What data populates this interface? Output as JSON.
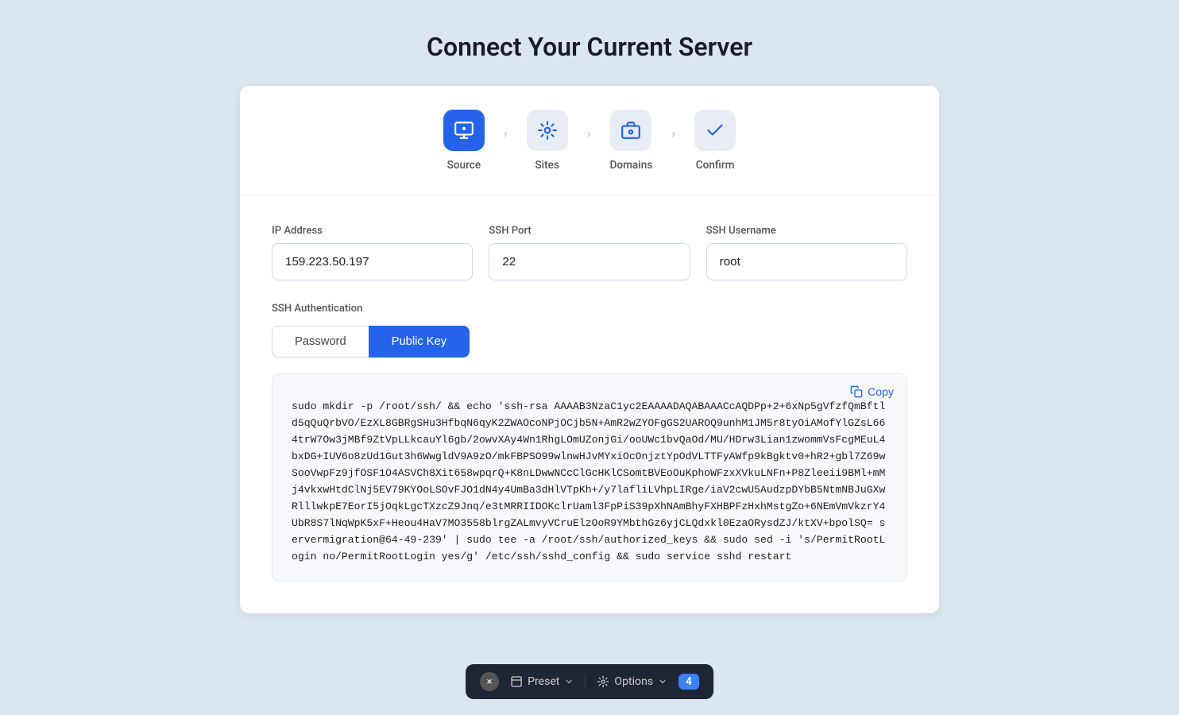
{
  "page": {
    "title": "Connect Your Current Server"
  },
  "steps": [
    {
      "id": "source",
      "label": "Source",
      "state": "active"
    },
    {
      "id": "sites",
      "label": "Sites",
      "state": "inactive"
    },
    {
      "id": "domains",
      "label": "Domains",
      "state": "inactive"
    },
    {
      "id": "confirm",
      "label": "Confirm",
      "state": "inactive"
    }
  ],
  "form": {
    "ip_address_label": "IP Address",
    "ip_address_value": "159.223.50.197",
    "ip_address_placeholder": "IP Address",
    "ssh_port_label": "SSH Port",
    "ssh_port_value": "22",
    "ssh_port_placeholder": "SSH Port",
    "ssh_username_label": "SSH Username",
    "ssh_username_value": "root",
    "ssh_username_placeholder": "SSH Username",
    "auth_label": "SSH Authentication",
    "tab_password": "Password",
    "tab_public_key": "Public Key",
    "copy_label": "Copy",
    "command": "sudo mkdir -p /root/ssh/ && echo 'ssh-rsa AAAAB3NzaC1yc2EAAAADAQABAAACcAQDPp+2+6xNp5gVfzfQmBftld5qQuQrbVO/EzXL8GBRgSHu3HfbqN6qyK2ZWAOcoNPjOCjb5N+AmR2wZYOFgGS2UAROQ9unhM1JM5r8tyOiAMofYlGZsL664trW7Ow3jMBf9ZtVpLLkcauYl6gb/2owvXAy4Wn1RhgLOmUZonjGi/ooUWc1bvQaOd/MU/HDrw3Lian1zwommVsFcgMEuL4bxDG+IUV6o8zUd1Gut3h6WwgldV9A9zO/mkFBPSO99wlnwHJvMYxiOcOnjztYpOdVLTTFyAWfp9kBgktv0+hR2+gbl7Z69wSooVwpFz9jfOSF1O4ASVCh8Xit658wpqrQ+K8nLDwwNCcClGcHKlCSomtBVEoOuKphoWFzxXVkuLNFn+P8Zleeii9BMl+mMj4vkxwHtdClNj5EV79KYOoLSOvFJO1dN4y4UmBa3dHlVTpKh+/y7lafliLVhpLIRge/iaV2cwU5AudzpDYbB5NtmNBJuGXwRlllwkpE7EorI5jOqkLgcTXzcZ9Jnq/e3tMRRIIDOKclrUaml3FpPiS39pXhNAmBhyFXHBPFzHxhMstgZo+6NEmVmVkzrY4UbR8S7lNqWpK5xF+Heou4HaV7MO3558blrgZALmvyVCruElzOoR9YMbthGz6yjCLQdxkl0EzaORysdZJ/ktXV+bpolSQ= servermigration@64-49-239' | sudo tee -a /root/ssh/authorized_keys && sudo sed -i 's/PermitRootLogin no/PermitRootLogin yes/g' /etc/ssh/sshd_config && sudo service sshd restart"
  },
  "toolbar": {
    "close_label": "×",
    "preset_label": "Preset",
    "options_label": "Options",
    "badge_count": "4"
  }
}
